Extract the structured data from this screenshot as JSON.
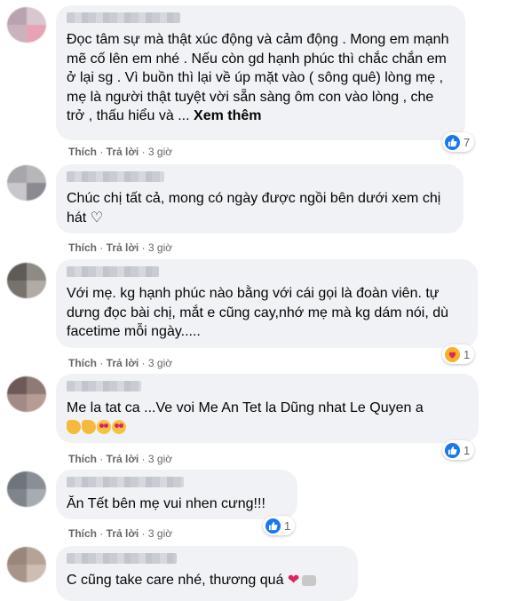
{
  "colors": {
    "like_blue": "#1877f2",
    "bubble_bg": "#f0f2f5",
    "meta_gray": "#65676b"
  },
  "comments": [
    {
      "text": "Đọc tâm sự mà thật xúc động và cảm động . Mong em mạnh mẽ cố lên em nhé . Nếu còn gd hạnh phúc thì chắc chắn em ở lại sg . Vì buồn thì lại về úp mặt vào ( sông quê) lòng mẹ , mẹ là người thật tuyệt vời sẵn sàng ôm con vào lòng , che trở , thấu hiểu và ...",
      "see_more": "Xem thêm",
      "like": "Thích",
      "reply": "Trả lời",
      "time": "3 giờ",
      "reaction_icon": "like-icon",
      "reaction_count": "7"
    },
    {
      "text": "Chúc chị tất cả, mong có ngày được ngồi bên dưới xem chị hát ♡",
      "like": "Thích",
      "reply": "Trả lời",
      "time": "3 giờ"
    },
    {
      "text": "Với mẹ. kg hạnh phúc nào bằng với cái gọi là đoàn viên. tự dưng đọc bài chị, mắt e cũng cay,nhớ mẹ mà kg dám nói, dù facetime mỗi ngày.....",
      "like": "Thích",
      "reply": "Trả lời",
      "time": "3 giờ",
      "reaction_icon": "care-icon",
      "reaction_count": "1"
    },
    {
      "text": "Me la tat ca ...Ve voi Me An Tet la Dũng nhat Le Quyen a",
      "emojis": [
        "clap-emoji",
        "clap-emoji",
        "heart-eyes-emoji",
        "heart-eyes-emoji"
      ],
      "like": "Thích",
      "reply": "Trả lời",
      "time": "3 giờ",
      "reaction_icon": "like-icon",
      "reaction_count": "1"
    },
    {
      "text": "Ăn Tết bên mẹ vui nhen cưng!!!",
      "like": "Thích",
      "reply": "Trả lời",
      "time": "3 giờ",
      "reaction_icon": "like-icon",
      "reaction_count": "1"
    },
    {
      "text": "C cũng take care nhé, thương quá",
      "emojis": [
        "red-heart-emoji"
      ]
    }
  ]
}
